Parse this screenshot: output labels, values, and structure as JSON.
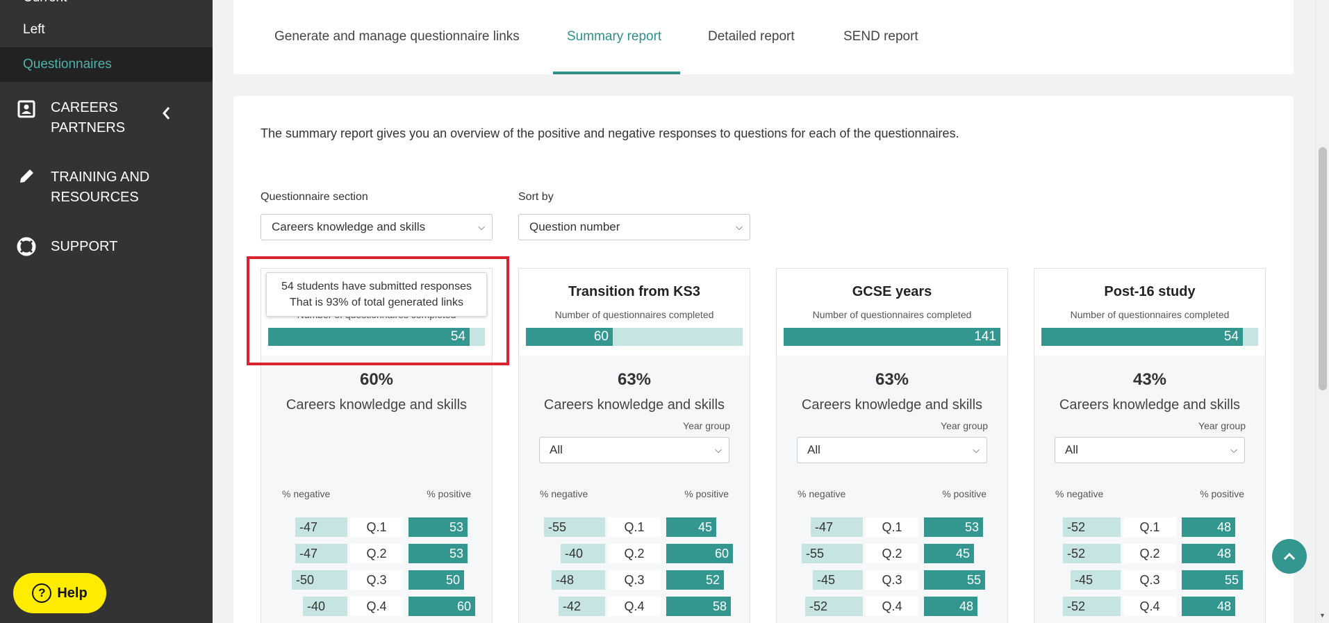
{
  "sidebar": {
    "cut_item": "Current",
    "sub_items": [
      {
        "label": "Left"
      },
      {
        "label": "Questionnaires"
      }
    ],
    "items": [
      {
        "label_line1": "CAREERS",
        "label_line2": "PARTNERS",
        "icon": "contact-card-icon"
      },
      {
        "label_line1": "TRAINING AND",
        "label_line2": "RESOURCES",
        "icon": "pencil-icon"
      },
      {
        "label_line1": "SUPPORT",
        "icon": "lifebuoy-icon"
      }
    ],
    "help_label": "Help"
  },
  "tabs": [
    {
      "label": "Generate and manage questionnaire links"
    },
    {
      "label": "Summary report"
    },
    {
      "label": "Detailed report"
    },
    {
      "label": "SEND report"
    }
  ],
  "intro": "The summary report gives you an overview of the positive and negative responses to questions for each of the questionnaires.",
  "filters": {
    "section_label": "Questionnaire section",
    "section_value": "Careers knowledge and skills",
    "sort_label": "Sort by",
    "sort_value": "Question number"
  },
  "tooltip": {
    "line1": "54 students have submitted responses",
    "line2": "That is 93% of total generated links"
  },
  "columns": [
    {
      "title": "",
      "completed_label": "Number of questionnaires completed",
      "completed": "54",
      "completed_fraction": 0.93,
      "pct": "60%",
      "section": "Careers knowledge and skills",
      "year_group_label": "",
      "year_group_value": "",
      "neg_label": "% negative",
      "pos_label": "% positive",
      "rows": [
        {
          "neg": "-47",
          "q": "Q.1",
          "pos": "53"
        },
        {
          "neg": "-47",
          "q": "Q.2",
          "pos": "53"
        },
        {
          "neg": "-50",
          "q": "Q.3",
          "pos": "50"
        },
        {
          "neg": "-40",
          "q": "Q.4",
          "pos": "60"
        }
      ]
    },
    {
      "title": "Transition from KS3",
      "completed_label": "Number of questionnaires completed",
      "completed": "60",
      "completed_fraction": 0.4,
      "pct": "63%",
      "section": "Careers knowledge and skills",
      "year_group_label": "Year group",
      "year_group_value": "All",
      "neg_label": "% negative",
      "pos_label": "% positive",
      "rows": [
        {
          "neg": "-55",
          "q": "Q.1",
          "pos": "45"
        },
        {
          "neg": "-40",
          "q": "Q.2",
          "pos": "60"
        },
        {
          "neg": "-48",
          "q": "Q.3",
          "pos": "52"
        },
        {
          "neg": "-42",
          "q": "Q.4",
          "pos": "58"
        }
      ]
    },
    {
      "title": "GCSE years",
      "completed_label": "Number of questionnaires completed",
      "completed": "141",
      "completed_fraction": 1.0,
      "pct": "63%",
      "section": "Careers knowledge and skills",
      "year_group_label": "Year group",
      "year_group_value": "All",
      "neg_label": "% negative",
      "pos_label": "% positive",
      "rows": [
        {
          "neg": "-47",
          "q": "Q.1",
          "pos": "53"
        },
        {
          "neg": "-55",
          "q": "Q.2",
          "pos": "45"
        },
        {
          "neg": "-45",
          "q": "Q.3",
          "pos": "55"
        },
        {
          "neg": "-52",
          "q": "Q.4",
          "pos": "48"
        }
      ]
    },
    {
      "title": "Post-16 study",
      "completed_label": "Number of questionnaires completed",
      "completed": "54",
      "completed_fraction": 0.93,
      "pct": "43%",
      "section": "Careers knowledge and skills",
      "year_group_label": "Year group",
      "year_group_value": "All",
      "neg_label": "% negative",
      "pos_label": "% positive",
      "rows": [
        {
          "neg": "-52",
          "q": "Q.1",
          "pos": "48"
        },
        {
          "neg": "-52",
          "q": "Q.2",
          "pos": "48"
        },
        {
          "neg": "-45",
          "q": "Q.3",
          "pos": "55"
        },
        {
          "neg": "-52",
          "q": "Q.4",
          "pos": "48"
        }
      ]
    }
  ],
  "colors": {
    "accent": "#33968f",
    "light_accent": "#c5e4e2",
    "sidebar_bg": "#333333",
    "help_bg": "#ffec00",
    "highlight": "#d9232e"
  }
}
